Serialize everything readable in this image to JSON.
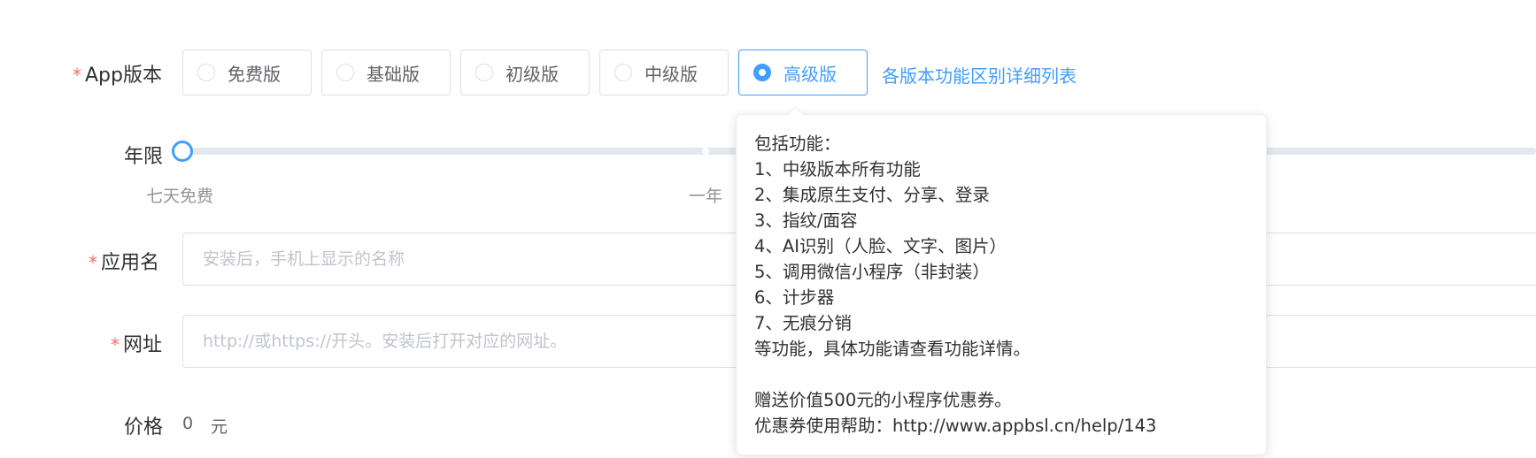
{
  "form": {
    "version_label": "App版本",
    "required_mark": "*",
    "versions": [
      "免费版",
      "基础版",
      "初级版",
      "中级版",
      "高级版"
    ],
    "selected_version": "高级版",
    "compare_link": "各版本功能区别详细列表",
    "term_label": "年限",
    "term_marks": [
      "七天免费",
      "一年"
    ],
    "term_value": "七天免费",
    "app_name_label": "应用名",
    "app_name_placeholder": "安装后，手机上显示的名称",
    "app_name_value": "",
    "url_label": "网址",
    "url_placeholder": "http://或https://开头。安装后打开对应的网址。",
    "url_value": "",
    "price_label": "价格",
    "price_value": "0",
    "price_unit": "元"
  },
  "tooltip": {
    "lines": [
      "包括功能：",
      "1、中级版本所有功能",
      "2、集成原生支付、分享、登录",
      "3、指纹/面容",
      "4、AI识别（人脸、文字、图片）",
      "5、调用微信小程序（非封装）",
      "6、计步器",
      "7、无痕分销",
      "等功能，具体功能请查看功能详情。",
      "",
      "赠送价值500元的小程序优惠券。",
      "优惠券使用帮助：http://www.appbsl.cn/help/143"
    ]
  },
  "colors": {
    "primary": "#409eff",
    "required": "#f56c6c",
    "border": "#dcdfe6",
    "placeholder": "#c0c4cc",
    "muted": "#909399"
  }
}
